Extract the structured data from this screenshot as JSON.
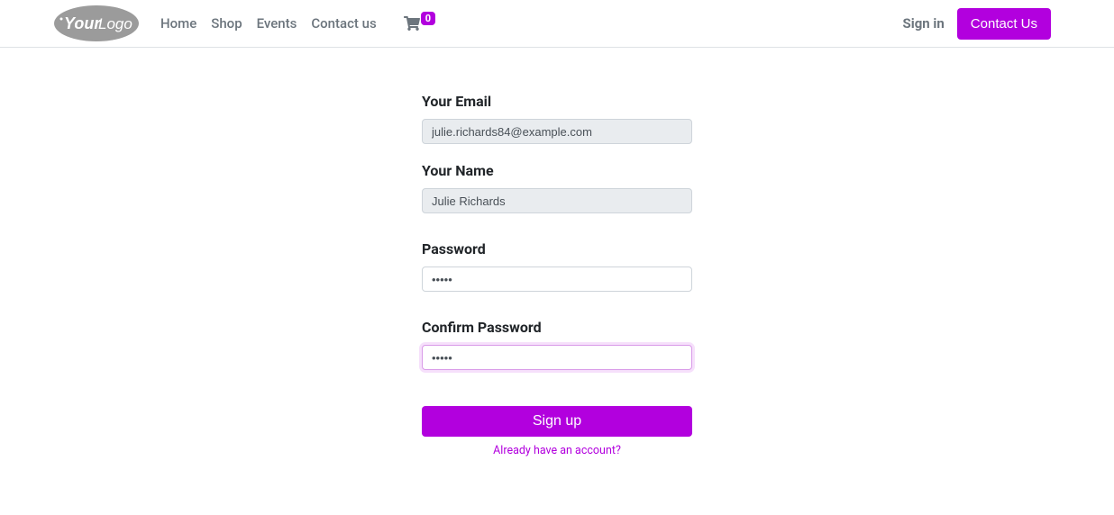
{
  "header": {
    "nav": {
      "home": "Home",
      "shop": "Shop",
      "events": "Events",
      "contact": "Contact us"
    },
    "cart_count": "0",
    "signin": "Sign in",
    "contact_btn": "Contact Us"
  },
  "form": {
    "email_label": "Your Email",
    "email_value": "julie.richards84@example.com",
    "name_label": "Your Name",
    "name_value": "Julie Richards",
    "password_label": "Password",
    "password_value": "•••••",
    "confirm_label": "Confirm Password",
    "confirm_value": "•••••",
    "submit": "Sign up",
    "login_link": "Already have an account?"
  }
}
